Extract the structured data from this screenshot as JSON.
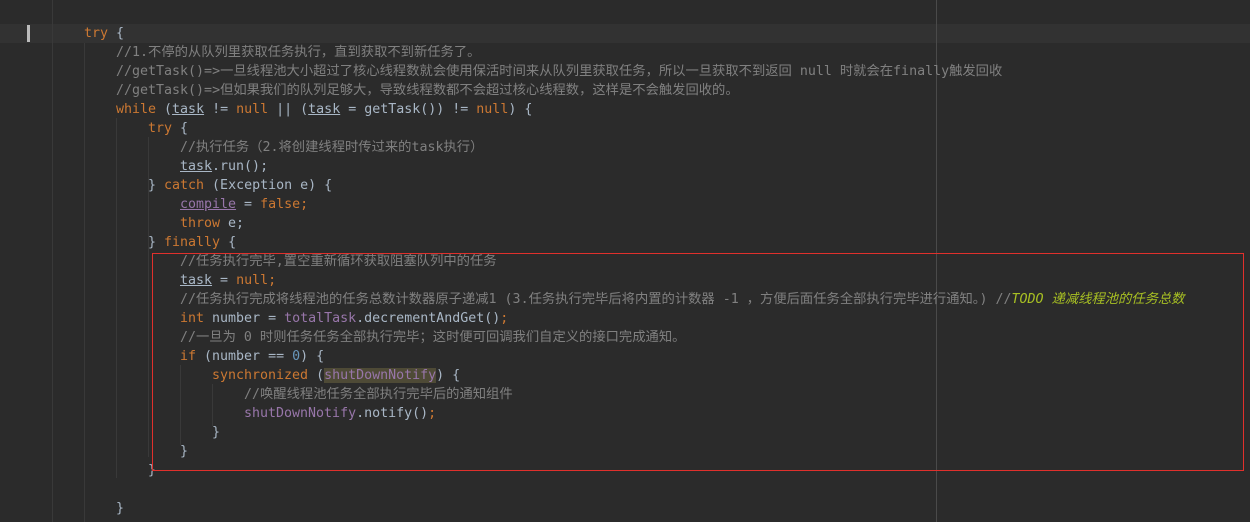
{
  "colors": {
    "background": "#2b2b2b",
    "keyword": "#cc7832",
    "comment": "#808080",
    "field": "#9876aa",
    "todo": "#a8c023",
    "number": "#6897bb",
    "text": "#a9b7c6",
    "highlight_box": "#e0302c"
  },
  "lines": [
    {
      "indent": 8,
      "tokens": [
        [
          "kw",
          "try"
        ],
        [
          "",
          "{"
        ]
      ]
    },
    {
      "indent": 12,
      "tokens": [
        [
          "cm",
          "//1.不停的从队列里获取任务执行，直到获取不到新任务了。"
        ]
      ]
    },
    {
      "indent": 12,
      "tokens": [
        [
          "cm",
          "//getTask()=>一旦线程池大小超过了核心线程数就会使用保活时间来从队列里获取任务，所以一旦获取不到返回 null 时就会在finally触发回收"
        ]
      ]
    },
    {
      "indent": 12,
      "tokens": [
        [
          "cm",
          "//getTask()=>但如果我们的队列足够大，导致线程数都不会超过核心线程数，这样是不会触发回收的。"
        ]
      ]
    },
    {
      "indent": 12,
      "tokens": [
        [
          "kw",
          "while"
        ],
        [
          "",
          " ("
        ],
        [
          "ul",
          "task"
        ],
        [
          "",
          " != "
        ],
        [
          "kw",
          "null"
        ],
        [
          "",
          " || ("
        ],
        [
          "ul",
          "task"
        ],
        [
          "",
          " = getTask()) != "
        ],
        [
          "kw",
          "null"
        ],
        [
          "",
          ") {"
        ]
      ]
    },
    {
      "indent": 16,
      "tokens": [
        [
          "kw",
          "try"
        ],
        [
          "",
          " {"
        ]
      ]
    },
    {
      "indent": 20,
      "tokens": [
        [
          "cm",
          "//执行任务（2.将创建线程时传过来的task执行）"
        ]
      ]
    },
    {
      "indent": 20,
      "tokens": [
        [
          "ul",
          "task"
        ],
        [
          "",
          ".run();"
        ]
      ]
    },
    {
      "indent": 16,
      "tokens": [
        [
          "",
          "} "
        ],
        [
          "kw",
          "catch"
        ],
        [
          "",
          " (Exception e) {"
        ]
      ]
    },
    {
      "indent": 20,
      "tokens": [
        [
          "ul fd",
          "compile"
        ],
        [
          "",
          " = "
        ],
        [
          "kw",
          "false;"
        ]
      ]
    },
    {
      "indent": 20,
      "tokens": [
        [
          "kw",
          "throw"
        ],
        [
          "",
          " e;"
        ]
      ]
    },
    {
      "indent": 16,
      "tokens": [
        [
          "",
          "} "
        ],
        [
          "kw",
          "finally"
        ],
        [
          "",
          " {"
        ]
      ]
    },
    {
      "indent": 20,
      "tokens": [
        [
          "cm",
          "//任务执行完毕,置空重新循环获取阻塞队列中的任务"
        ]
      ]
    },
    {
      "indent": 20,
      "tokens": [
        [
          "ul",
          "task"
        ],
        [
          "",
          " = "
        ],
        [
          "kw",
          "null;"
        ]
      ]
    },
    {
      "indent": 20,
      "tokens": [
        [
          "cm",
          "//任务执行完成将线程池的任务总数计数器原子递减1 (3.任务执行完毕后将内置的计数器 -1 ，方便后面任务全部执行完毕进行通知。) //"
        ],
        [
          "todo",
          "TODO 递减线程池的任务总数"
        ]
      ]
    },
    {
      "indent": 20,
      "tokens": [
        [
          "kw",
          "int"
        ],
        [
          "",
          " number = "
        ],
        [
          "fd",
          "totalTask"
        ],
        [
          "",
          ".decrementAndGet()"
        ],
        [
          "kw",
          ";"
        ]
      ]
    },
    {
      "indent": 20,
      "tokens": [
        [
          "cm",
          "//一旦为 0 时则任务任务全部执行完毕；这时便可回调我们自定义的接口完成通知。"
        ]
      ]
    },
    {
      "indent": 20,
      "tokens": [
        [
          "kw",
          "if"
        ],
        [
          "",
          " (number == "
        ],
        [
          "num",
          "0"
        ],
        [
          "",
          ") {"
        ]
      ]
    },
    {
      "indent": 24,
      "tokens": [
        [
          "kw",
          "synchronized"
        ],
        [
          "",
          " ("
        ],
        [
          "fd hl",
          "shutDownNotify"
        ],
        [
          "",
          ") {"
        ]
      ]
    },
    {
      "indent": 28,
      "tokens": [
        [
          "cm",
          "//唤醒线程池任务全部执行完毕后的通知组件"
        ]
      ]
    },
    {
      "indent": 28,
      "tokens": [
        [
          "fd",
          "shutDownNotify"
        ],
        [
          "",
          ".notify()"
        ],
        [
          "kw",
          ";"
        ]
      ]
    },
    {
      "indent": 24,
      "tokens": [
        [
          "",
          "}"
        ]
      ]
    },
    {
      "indent": 20,
      "tokens": [
        [
          "",
          "}"
        ]
      ]
    },
    {
      "indent": 16,
      "tokens": [
        [
          "",
          "}"
        ]
      ]
    },
    {
      "indent": 0,
      "tokens": []
    },
    {
      "indent": 12,
      "tokens": [
        [
          "",
          "}"
        ]
      ]
    }
  ]
}
